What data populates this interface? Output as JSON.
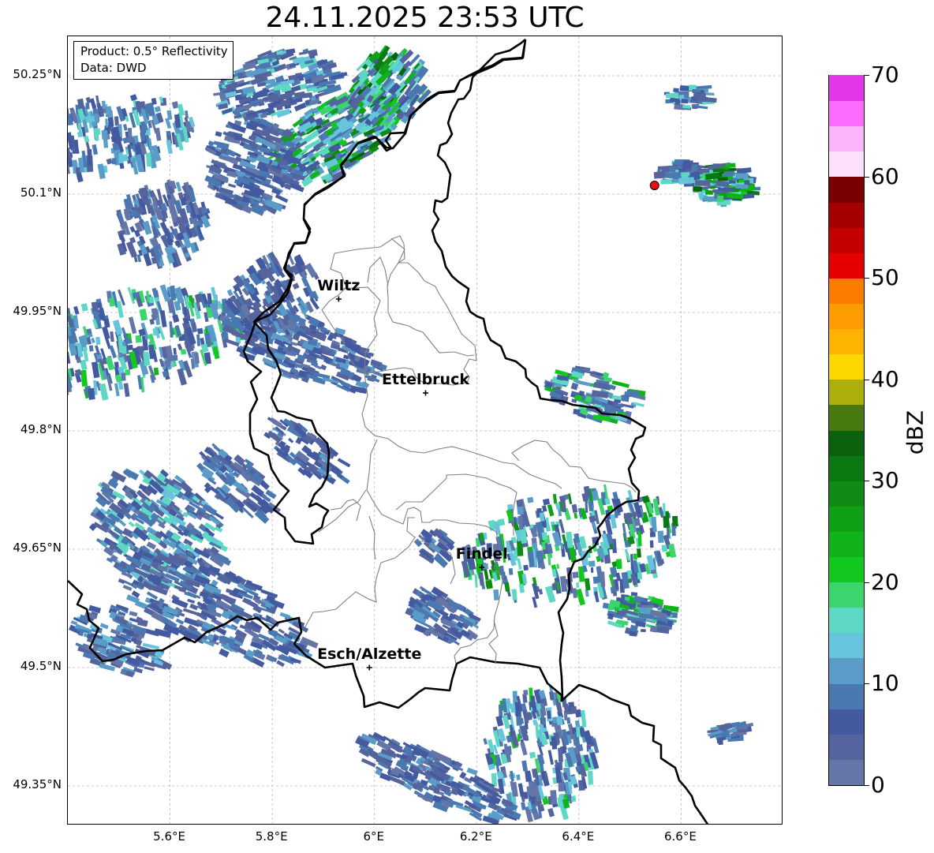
{
  "title": "24.11.2025 23:53 UTC",
  "info": {
    "product": "Product: 0.5° Reflectivity",
    "data": "Data: DWD"
  },
  "map": {
    "lon_range": [
      5.4,
      6.8
    ],
    "lat_range": [
      49.3,
      50.3
    ],
    "lon_ticks": [
      {
        "value": 5.6,
        "label": "5.6°E"
      },
      {
        "value": 5.8,
        "label": "5.8°E"
      },
      {
        "value": 6.0,
        "label": "6°E"
      },
      {
        "value": 6.2,
        "label": "6.2°E"
      },
      {
        "value": 6.4,
        "label": "6.4°E"
      },
      {
        "value": 6.6,
        "label": "6.6°E"
      }
    ],
    "lat_ticks": [
      {
        "value": 50.25,
        "label": "50.25°N"
      },
      {
        "value": 50.1,
        "label": "50.1°N"
      },
      {
        "value": 49.95,
        "label": "49.95°N"
      },
      {
        "value": 49.8,
        "label": "49.8°N"
      },
      {
        "value": 49.65,
        "label": "49.65°N"
      },
      {
        "value": 49.5,
        "label": "49.5°N"
      },
      {
        "value": 49.35,
        "label": "49.35°N"
      }
    ],
    "cities": [
      {
        "name": "Wiltz",
        "lon": 5.93,
        "lat": 49.967
      },
      {
        "name": "Ettelbruck",
        "lon": 6.1,
        "lat": 49.848
      },
      {
        "name": "Findel",
        "lon": 6.21,
        "lat": 49.627
      },
      {
        "name": "Esch/Alzette",
        "lon": 5.99,
        "lat": 49.5
      }
    ],
    "radar_site": {
      "lon": 6.548,
      "lat": 50.111,
      "color": "#e81010"
    }
  },
  "colorbar": {
    "label": "dBZ",
    "min": 0,
    "max": 70,
    "tick_labels": [
      "0",
      "10",
      "20",
      "30",
      "40",
      "50",
      "60",
      "70"
    ],
    "colors": [
      "#6475a8",
      "#55649c",
      "#435aa0",
      "#4a78b0",
      "#5a9cc8",
      "#66c4dc",
      "#5cd8c4",
      "#3cd46c",
      "#12c81e",
      "#10b41a",
      "#10a016",
      "#108c14",
      "#0c7812",
      "#0a620e",
      "#487a10",
      "#acae0c",
      "#fcd800",
      "#fcb400",
      "#fc9c00",
      "#fc7c00",
      "#e40000",
      "#c40000",
      "#a40000",
      "#780000",
      "#fce0fc",
      "#fcb4fc",
      "#fc6cfc",
      "#e438e8"
    ]
  }
}
